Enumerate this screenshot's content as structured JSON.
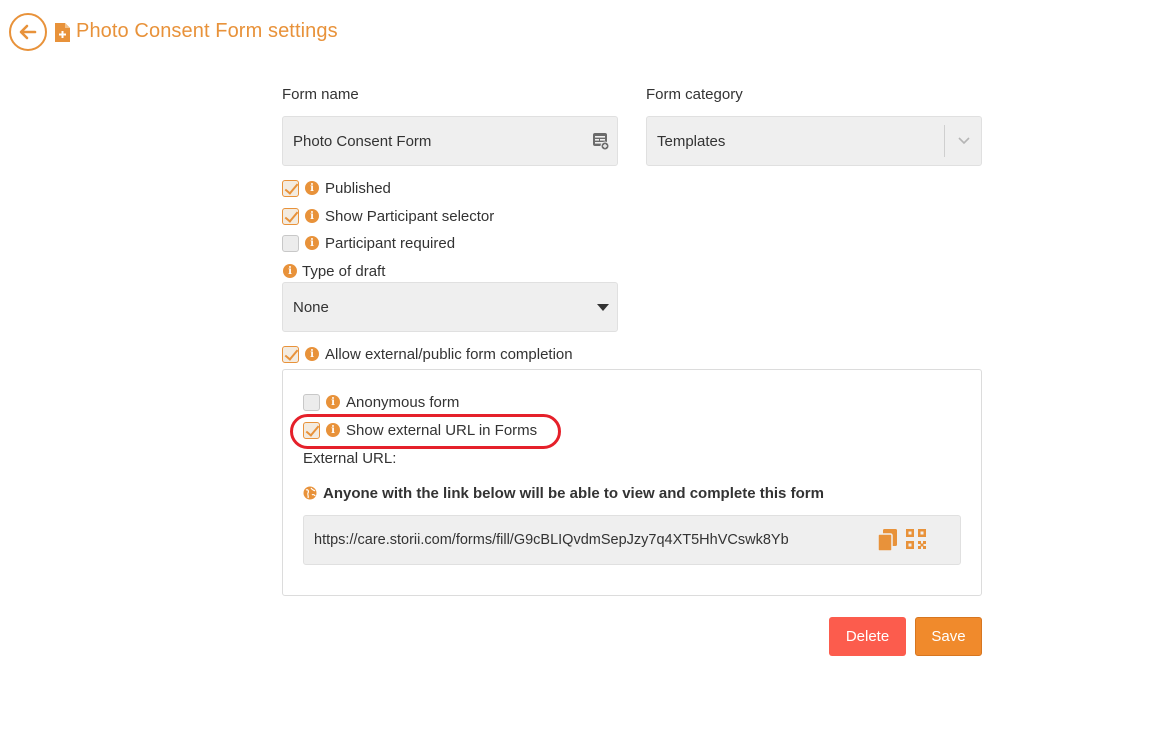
{
  "header": {
    "title": "Photo Consent Form settings"
  },
  "form": {
    "name_label": "Form name",
    "name_value": "Photo Consent Form",
    "category_label": "Form category",
    "category_value": "Templates",
    "published_label": "Published",
    "published_checked": true,
    "participant_selector_label": "Show Participant selector",
    "participant_selector_checked": true,
    "participant_required_label": "Participant required",
    "participant_required_checked": false,
    "draft_type_label": "Type of draft",
    "draft_type_value": "None",
    "allow_external_label": "Allow external/public form completion",
    "allow_external_checked": true
  },
  "external_panel": {
    "anonymous_label": "Anonymous form",
    "anonymous_checked": false,
    "show_url_label": "Show external URL in Forms",
    "show_url_checked": true,
    "external_url_label": "External URL:",
    "notice": "Anyone with the link below will be able to view and complete this form",
    "url": "https://care.storii.com/forms/fill/G9cBLIQvdmSepJzy7q4XT5HhVCswk8Yb"
  },
  "actions": {
    "delete_label": "Delete",
    "save_label": "Save"
  },
  "colors": {
    "accent": "#e8923a",
    "delete": "#fc5c4d",
    "save": "#f08a2c",
    "highlight": "#e5202a"
  },
  "icons": {
    "back": "arrow-left-icon",
    "form": "document-plus-icon",
    "field_tags": "tag-list-icon",
    "dropdown": "chevron-down-icon",
    "info": "info-icon",
    "globe": "globe-icon",
    "copy": "copy-icon",
    "qr": "qr-code-icon"
  }
}
